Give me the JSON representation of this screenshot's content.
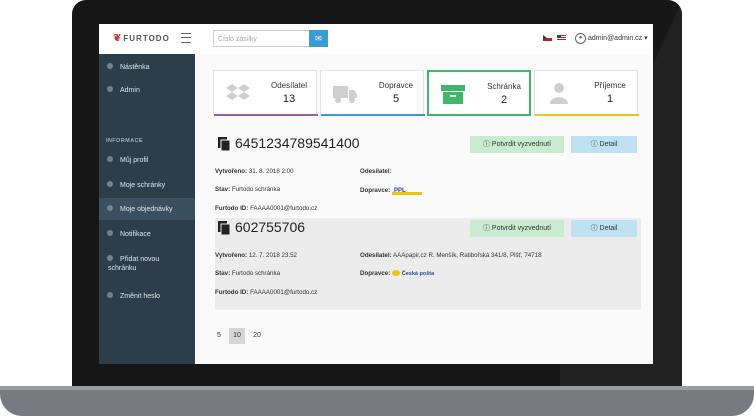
{
  "app": {
    "logo_text": "FURTODO",
    "search_placeholder": "Číslo zásilky",
    "user": "admin@admin.cz",
    "user_caret": "▾",
    "search_icon": "envelope-icon"
  },
  "sidebar": {
    "section_header": "INFORMACE",
    "items": [
      {
        "label": "Nástěnka",
        "icon": "dashboard-icon"
      },
      {
        "label": "Admin",
        "icon": "user-icon"
      },
      {
        "label": "Můj profil",
        "icon": "profile-icon"
      },
      {
        "label": "Moje schránky",
        "icon": "boxes-icon"
      },
      {
        "label": "Moje objednávky",
        "icon": "orders-icon",
        "active": true
      },
      {
        "label": "Notifikace",
        "icon": "bell-icon"
      },
      {
        "label": "Přidat novou schránku",
        "icon": "plus-icon"
      },
      {
        "label": "Změnit heslo",
        "icon": "lock-icon"
      }
    ]
  },
  "cards": [
    {
      "title": "Odesílatel",
      "count": "13",
      "accent": "#9b59b6",
      "icon": "dropbox-icon"
    },
    {
      "title": "Dopravce",
      "count": "5",
      "accent": "#3a9bd9",
      "icon": "truck-icon"
    },
    {
      "title": "Schránka",
      "count": "2",
      "accent": "#3eb86b",
      "icon": "box-icon",
      "selected": true
    },
    {
      "title": "Příjemce",
      "count": "1",
      "accent": "#f1c40f",
      "icon": "person-icon"
    }
  ],
  "packages": [
    {
      "id": "6451234789541400",
      "confirm_label": "Potvrdit vyzvednutí",
      "detail_label": "Detail",
      "created_label": "Vytvořeno:",
      "created": "31. 8. 2018 2:00",
      "state_label": "Stav:",
      "state": "Furtodo schránka",
      "furtodo_id_label": "Furtodo ID:",
      "furtodo_id": "FAAAA0001@furtodo.cz",
      "sender_label": "Odesílatel:",
      "sender": "",
      "carrier_label": "Dopravce:",
      "carrier_logo": "PPL",
      "carrier_icon": "ppl-logo"
    },
    {
      "id": "602755706",
      "confirm_label": "Potvrdit vyzvednutí",
      "detail_label": "Detail",
      "created_label": "Vytvořeno:",
      "created": "12. 7. 2018 23:52",
      "state_label": "Stav:",
      "state": "Furtodo schránka",
      "furtodo_id_label": "Furtodo ID:",
      "furtodo_id": "FAAAA0001@furtodo.cz",
      "sender_label": "Odesílatel:",
      "sender": "AAApapir.cz R. Menšík, Ratibořská 341/8, Plšť, 74718",
      "carrier_label": "Dopravce:",
      "carrier_logo": "Česká pošta",
      "carrier_icon": "ceska-posta-logo"
    }
  ],
  "pagination": [
    "5",
    "10",
    "20"
  ],
  "pagination_active": "10"
}
